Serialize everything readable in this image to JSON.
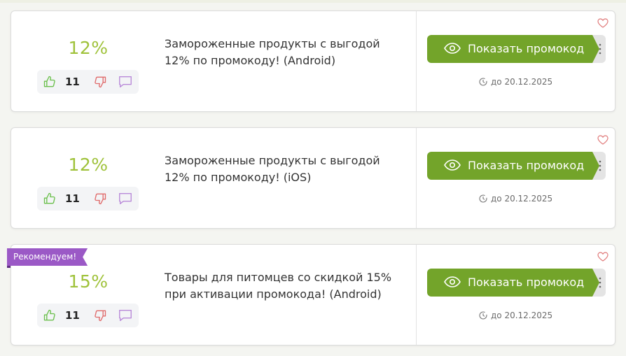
{
  "colors": {
    "accent_green": "#73a42a",
    "percent_green": "#9fc23a",
    "badge_purple": "#9b59c6",
    "thumb_up": "#6abf4b",
    "thumb_down": "#e06a6a",
    "comment": "#b98ad9",
    "favorite": "#e07a7a"
  },
  "offers": [
    {
      "percent": "12%",
      "votes": "11",
      "description_line1": "Замороженные продукты с выгодой",
      "description_line2": "12% по промокоду! (Android)",
      "button_label": "Показать промокод",
      "expiry": "до 20.12.2025",
      "badge": ""
    },
    {
      "percent": "12%",
      "votes": "11",
      "description_line1": "Замороженные продукты с выгодой",
      "description_line2": "12% по промокоду! (iOS)",
      "button_label": "Показать промокод",
      "expiry": "до 20.12.2025",
      "badge": ""
    },
    {
      "percent": "15%",
      "votes": "11",
      "description_line1": "Товары для питомцев со скидкой 15%",
      "description_line2": "при активации промокода! (Android)",
      "button_label": "Показать промокод",
      "expiry": "до 20.12.2025",
      "badge": "Рекомендуем!"
    }
  ],
  "icons": {
    "vote_up": "thumb-up-icon",
    "vote_down": "thumb-down-icon",
    "comment": "comment-icon",
    "show": "eye-icon",
    "more": "kebab-menu-icon",
    "expiry": "clock-icon",
    "favorite": "heart-icon"
  }
}
